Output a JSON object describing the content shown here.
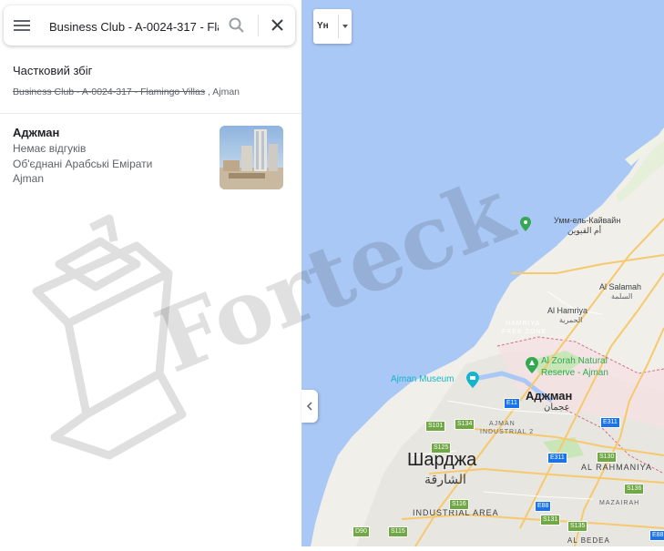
{
  "search": {
    "value": "Business Club - A-0024-317 - Fla",
    "menu_icon": "hamburger-menu-icon",
    "search_icon": "search-icon",
    "clear_icon": "close-icon"
  },
  "partial_match": {
    "heading": "Частковий збіг",
    "struck_text": "Business Club - A-0024-317 - Flamingo Villas",
    "suffix": " , Ajman"
  },
  "result": {
    "name": "Аджман",
    "reviews": "Немає відгуків",
    "country": "Об'єднані Арабські Емірати",
    "city": "Ajman"
  },
  "map": {
    "layer_button_label": "Yн",
    "places": {
      "umm_al_quwain_en": "Умм-ель-Кайвайн",
      "umm_al_quwain_ar": "أم القيوين",
      "al_salamah_en": "Al Salamah",
      "al_salamah_ar": "السلمة",
      "al_hamriya_en": "Al Hamriya",
      "al_hamriya_ar": "الحمرية",
      "hamriya_free_zone_1": "HAMRIYA",
      "hamriya_free_zone_2": "FREE ZONE",
      "al_zorah_1": "Al Zorah Natural",
      "al_zorah_2": "Reserve - Ajman",
      "ajman_museum": "Ajman Museum",
      "ajman_ua": "Аджман",
      "ajman_ar": "عجمان",
      "ajman_industrial_1": "AJMAN",
      "ajman_industrial_2": "INDUSTRIAL 2",
      "sharjah_ua": "Шарджа",
      "sharjah_ar": "الشارقة",
      "al_rahmaniya": "AL RAHMANIYA",
      "industrial_area": "INDUSTRIAL AREA",
      "mazairah": "MAZAIRAH",
      "al_bedea": "AL BEDEA"
    },
    "road_shields": [
      "E11",
      "E311",
      "E311",
      "S101",
      "S134",
      "S125",
      "S130",
      "S136",
      "S116",
      "S131",
      "S135",
      "E88",
      "E88",
      "S115",
      "D90"
    ]
  },
  "colors": {
    "water": "#aac8f5",
    "land": "#f1efe9",
    "urban": "#e8e6e1",
    "park": "#c8e6b8",
    "road_major": "#f7c96e",
    "boundary": "#d97083",
    "text_dark": "#202124",
    "text_secondary": "#5f6368",
    "poi_green": "#34a853",
    "poi_teal": "#12b5cb"
  },
  "watermark": {
    "text": "Forteck"
  }
}
